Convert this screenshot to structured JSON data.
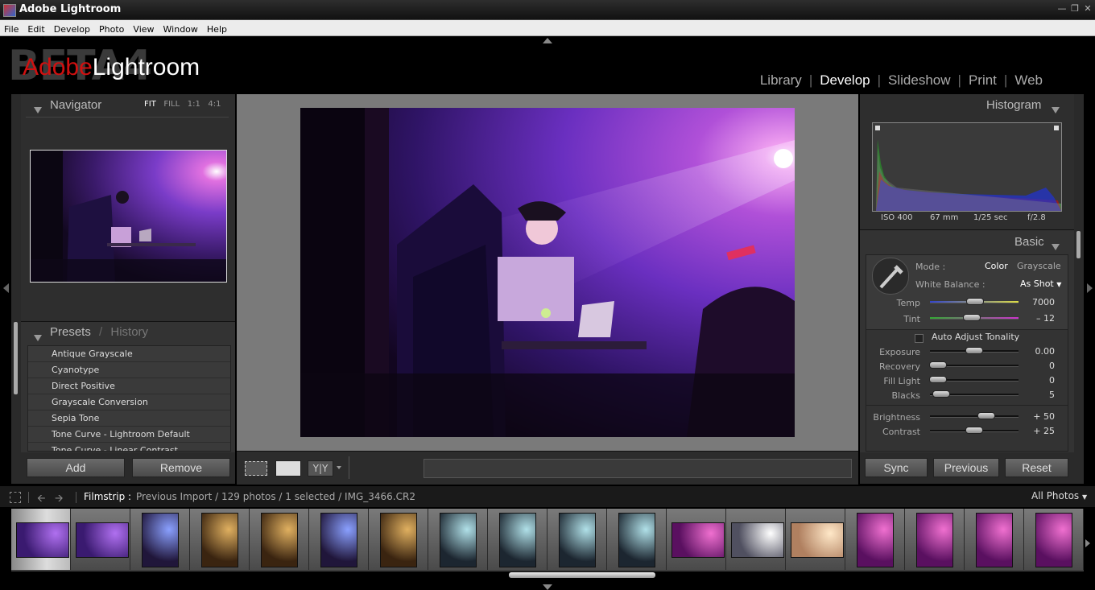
{
  "window": {
    "title": "Adobe Lightroom"
  },
  "menu": [
    "File",
    "Edit",
    "Develop",
    "Photo",
    "View",
    "Window",
    "Help"
  ],
  "branding": {
    "beta": "BETA4",
    "adobe": "Adobe",
    "lightroom": "Lightroom"
  },
  "modules": {
    "items": [
      "Library",
      "Develop",
      "Slideshow",
      "Print",
      "Web"
    ],
    "active": "Develop"
  },
  "navigator": {
    "title": "Navigator",
    "zoom_options": [
      "FIT",
      "FILL",
      "1:1",
      "4:1"
    ],
    "active_zoom": "FIT"
  },
  "presets": {
    "title": "Presets",
    "separator": "/",
    "history_tab": "History",
    "items": [
      "Antique Grayscale",
      "Cyanotype",
      "Direct Positive",
      "Grayscale Conversion",
      "Sepia Tone",
      "Tone Curve - Lightroom Default",
      "Tone Curve - Linear Contrast"
    ]
  },
  "left_buttons": {
    "add": "Add",
    "remove": "Remove"
  },
  "histogram": {
    "title": "Histogram",
    "exif": {
      "iso": "ISO 400",
      "focal": "67 mm",
      "shutter": "1/25 sec",
      "aperture": "f/2.8"
    }
  },
  "basic": {
    "title": "Basic",
    "mode_label": "Mode :",
    "mode_options": [
      "Color",
      "Grayscale"
    ],
    "mode_selected": "Color",
    "wb_label": "White Balance :",
    "wb_value": "As Shot",
    "auto_tone": "Auto Adjust Tonality",
    "sliders": [
      {
        "label": "Temp",
        "value": "7000",
        "position": 0.5
      },
      {
        "label": "Tint",
        "value": "– 12",
        "position": 0.47
      },
      {
        "label": "Exposure",
        "value": "0.00",
        "position": 0.5
      },
      {
        "label": "Recovery",
        "value": "0",
        "position": 0.04
      },
      {
        "label": "Fill Light",
        "value": "0",
        "position": 0.04
      },
      {
        "label": "Blacks",
        "value": "5",
        "position": 0.1
      },
      {
        "label": "Brightness",
        "value": "+ 50",
        "position": 0.62
      },
      {
        "label": "Contrast",
        "value": "+ 25",
        "position": 0.5
      }
    ]
  },
  "right_buttons": {
    "sync": "Sync",
    "previous": "Previous",
    "reset": "Reset"
  },
  "toolbar": {
    "compare": "Y|Y"
  },
  "filmstrip": {
    "label": "Filmstrip :",
    "path": "Previous Import / 129 photos / 1 selected / IMG_3466.CR2",
    "filter": "All Photos",
    "thumbnails": [
      {
        "orientation": "landscape",
        "tone": "purple",
        "selected": true
      },
      {
        "orientation": "landscape",
        "tone": "purple",
        "selected": false
      },
      {
        "orientation": "portrait",
        "tone": "blue",
        "selected": false
      },
      {
        "orientation": "portrait",
        "tone": "amber",
        "selected": false
      },
      {
        "orientation": "portrait",
        "tone": "amber",
        "selected": false
      },
      {
        "orientation": "portrait",
        "tone": "blue",
        "selected": false
      },
      {
        "orientation": "portrait",
        "tone": "amber",
        "selected": false
      },
      {
        "orientation": "portrait",
        "tone": "cyan",
        "selected": false
      },
      {
        "orientation": "portrait",
        "tone": "cyan",
        "selected": false
      },
      {
        "orientation": "portrait",
        "tone": "cyan",
        "selected": false
      },
      {
        "orientation": "portrait",
        "tone": "cyan",
        "selected": false
      },
      {
        "orientation": "landscape",
        "tone": "magenta",
        "selected": false
      },
      {
        "orientation": "landscape",
        "tone": "white",
        "selected": false
      },
      {
        "orientation": "landscape",
        "tone": "warm",
        "selected": false
      },
      {
        "orientation": "portrait",
        "tone": "magenta",
        "selected": false
      },
      {
        "orientation": "portrait",
        "tone": "magenta",
        "selected": false
      },
      {
        "orientation": "portrait",
        "tone": "magenta",
        "selected": false
      },
      {
        "orientation": "portrait",
        "tone": "magenta",
        "selected": false
      }
    ]
  },
  "colors": {
    "accent_red": "#d01010",
    "panel_bg": "#333333",
    "canvas_bg": "#7a7a7a"
  }
}
